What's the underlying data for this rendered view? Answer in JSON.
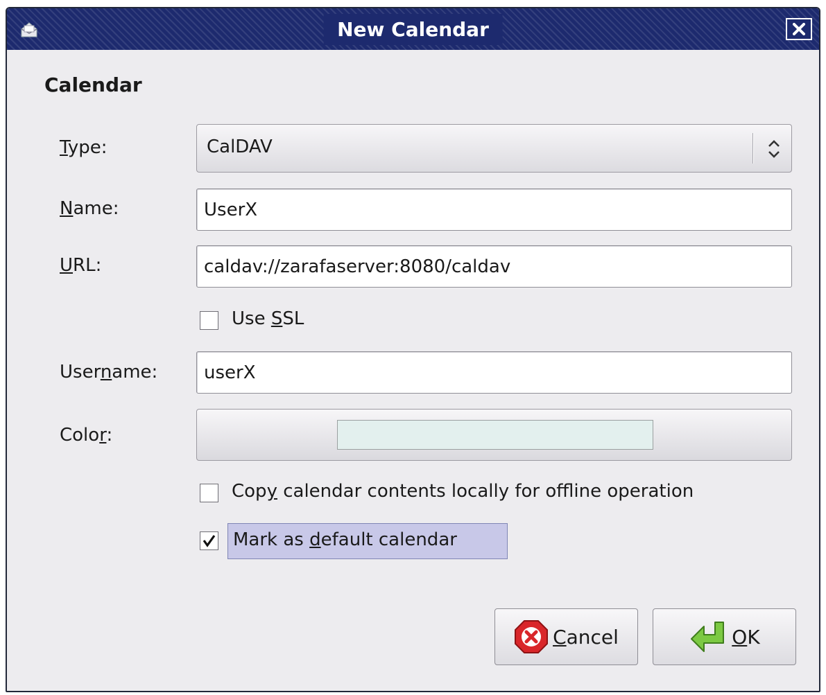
{
  "window": {
    "title": "New Calendar"
  },
  "section": {
    "title": "Calendar"
  },
  "type_field": {
    "label_prefix": "",
    "label_mnemonic": "T",
    "label_suffix": "ype:",
    "value": "CalDAV"
  },
  "name_field": {
    "label_prefix": "",
    "label_mnemonic": "N",
    "label_suffix": "ame:",
    "value": "UserX"
  },
  "url_field": {
    "label_prefix": "",
    "label_mnemonic": "U",
    "label_suffix": "RL:",
    "value": "caldav://zarafaserver:8080/caldav"
  },
  "use_ssl": {
    "label_prefix": "Use ",
    "label_mnemonic": "S",
    "label_suffix": "SL",
    "checked": false
  },
  "username_field": {
    "label_prefix": "User",
    "label_mnemonic": "n",
    "label_suffix": "ame:",
    "value": "userX"
  },
  "color_field": {
    "label_prefix": "Colo",
    "label_mnemonic": "r",
    "label_suffix": ":",
    "swatch_color": "#e3f0ee"
  },
  "offline_copy": {
    "label_prefix": "Cop",
    "label_mnemonic": "y",
    "label_suffix": " calendar contents locally for offline operation",
    "checked": false
  },
  "default_calendar": {
    "label_prefix": "Mark as ",
    "label_mnemonic": "d",
    "label_suffix": "efault calendar",
    "checked": true
  },
  "buttons": {
    "cancel": {
      "label_prefix": "",
      "label_mnemonic": "C",
      "label_suffix": "ancel",
      "icon": "cancel-icon"
    },
    "ok": {
      "label_prefix": "",
      "label_mnemonic": "O",
      "label_suffix": "K",
      "icon": "ok-arrow-icon"
    }
  },
  "colors": {
    "titlebar": "#1d2a6e",
    "dialog_bg": "#edecef",
    "focus_highlight": "#c8c8e8",
    "cancel_icon": "#d9262a",
    "ok_icon": "#7cc943"
  }
}
